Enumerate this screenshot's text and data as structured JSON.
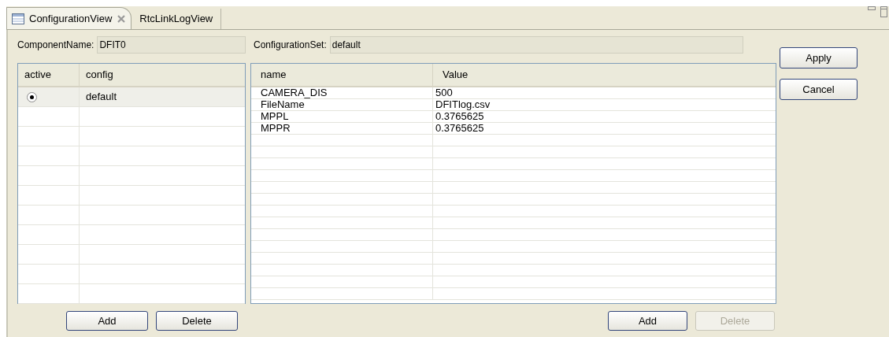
{
  "tabs": [
    {
      "label": "ConfigurationView",
      "selected": true,
      "closable": true
    },
    {
      "label": "RtcLinkLogView",
      "selected": false,
      "closable": false
    }
  ],
  "component": {
    "label": "ComponentName:",
    "value": "DFIT0"
  },
  "configuration_set": {
    "label": "ConfigurationSet:",
    "value": "default"
  },
  "config_table": {
    "columns": [
      "active",
      "config"
    ],
    "rows": [
      {
        "active": true,
        "config": "default",
        "selected": true
      }
    ],
    "buttons": [
      {
        "label": "Add",
        "disabled": false
      },
      {
        "label": "Delete",
        "disabled": false
      }
    ]
  },
  "param_table": {
    "columns": [
      "name",
      "Value"
    ],
    "rows": [
      {
        "name": "CAMERA_DIS",
        "value": "500"
      },
      {
        "name": "FileName",
        "value": "DFITlog.csv"
      },
      {
        "name": "MPPL",
        "value": "0.3765625"
      },
      {
        "name": "MPPR",
        "value": "0.3765625"
      }
    ],
    "buttons": [
      {
        "label": "Add",
        "disabled": false
      },
      {
        "label": "Delete",
        "disabled": true
      }
    ]
  },
  "side_buttons": [
    {
      "label": "Apply"
    },
    {
      "label": "Cancel"
    }
  ]
}
